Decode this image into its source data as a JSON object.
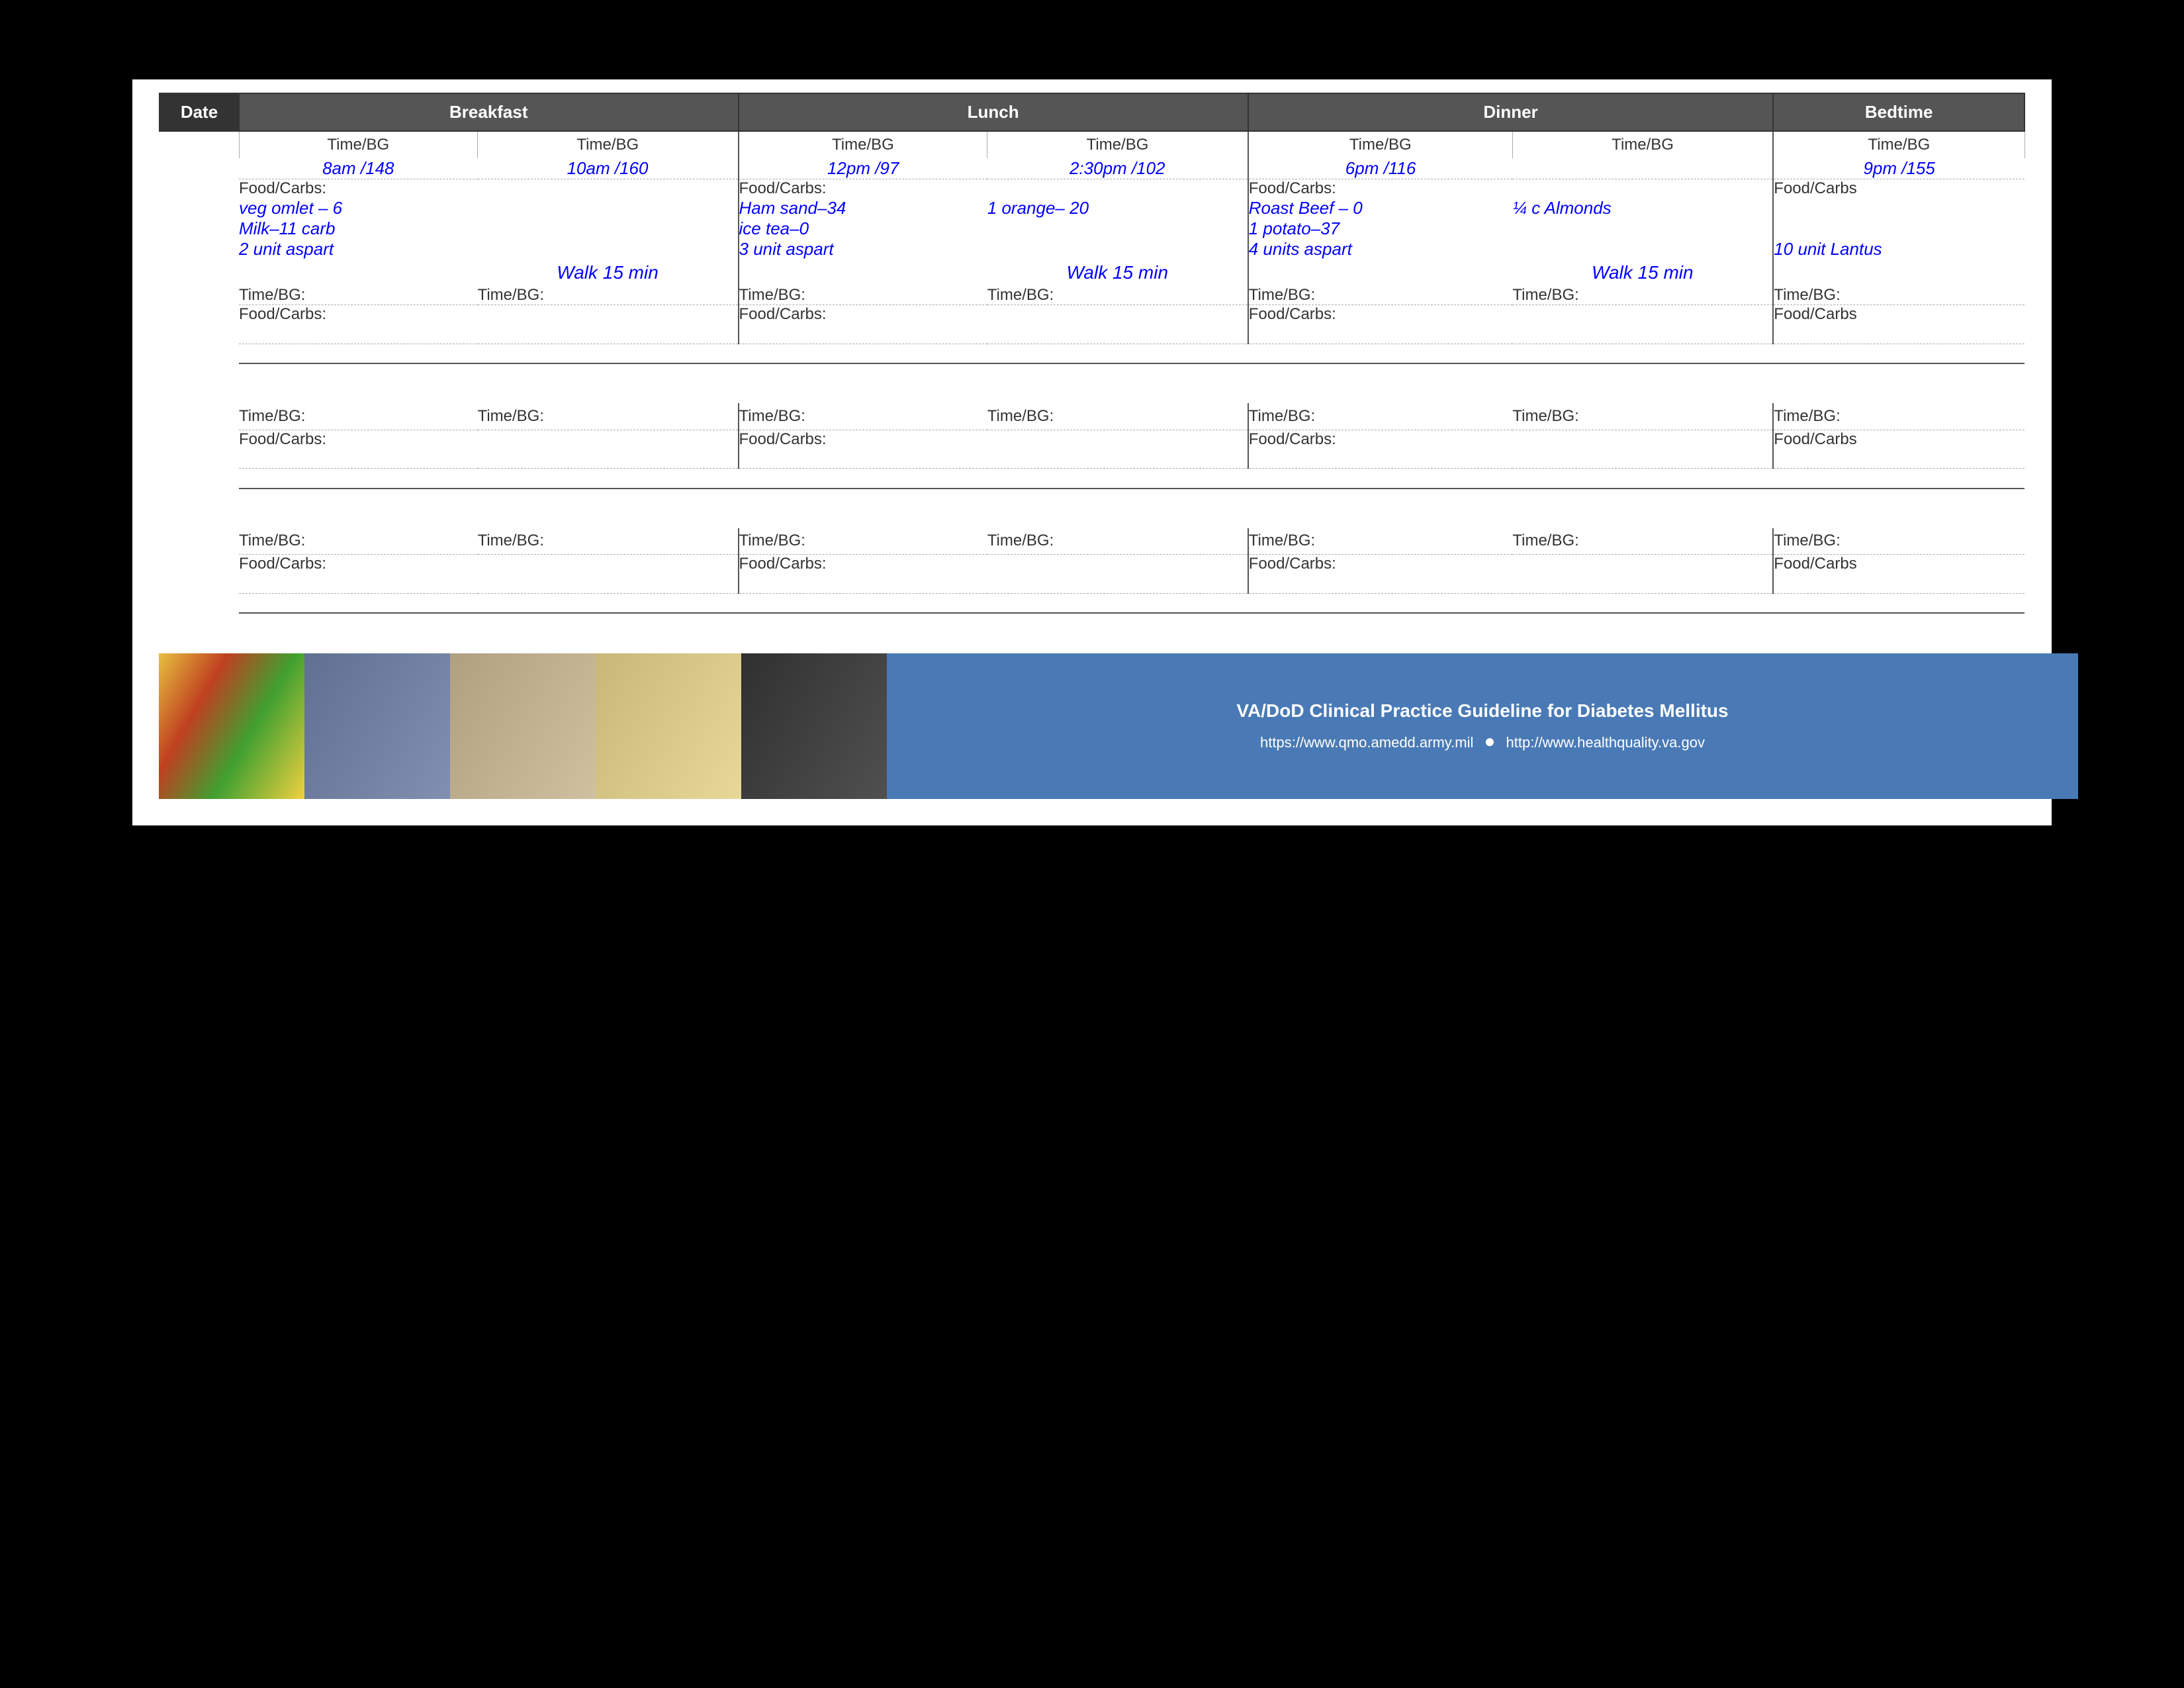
{
  "header": {
    "date_col": "Date",
    "breakfast_col": "Breakfast",
    "lunch_col": "Lunch",
    "dinner_col": "Dinner",
    "bedtime_col": "Bedtime"
  },
  "subheader": {
    "time_bg": "Time/BG"
  },
  "row1": {
    "time_bg_1": "8am /148",
    "time_bg_2": "10am /160",
    "time_bg_3": "12pm /97",
    "time_bg_4": "2:30pm /102",
    "time_bg_5": "6pm /116",
    "time_bg_6": "",
    "time_bg_7": "9pm /155",
    "food_label_1": "Food/Carbs:",
    "food_label_2": "Food/Carbs:",
    "food_label_3": "Food/Carbs:",
    "food_label_4": "Food/Carbs",
    "food_1": "veg omlet – 6",
    "food_2": "Ham sand–34",
    "food_3": "1 orange– 20",
    "food_4": "Roast Beef – 0",
    "food_5": "¼ c Almonds",
    "food_6": "Milk–11 carb",
    "food_7": "ice tea–0",
    "food_8": "1 potato–37",
    "insulin_1": "2 unit aspart",
    "insulin_2": "3 unit aspart",
    "insulin_3": "4 units aspart",
    "insulin_4": "10 unit Lantus",
    "walk_1": "Walk 15 min",
    "walk_2": "Walk 15 min",
    "walk_3": "Walk 15 min"
  },
  "footer": {
    "title": "VA/DoD Clinical Practice Guideline for Diabetes Mellitus",
    "url1": "https://www.qmo.amedd.army.mil",
    "dot": "●",
    "url2": "http://www.healthquality.va.gov"
  }
}
